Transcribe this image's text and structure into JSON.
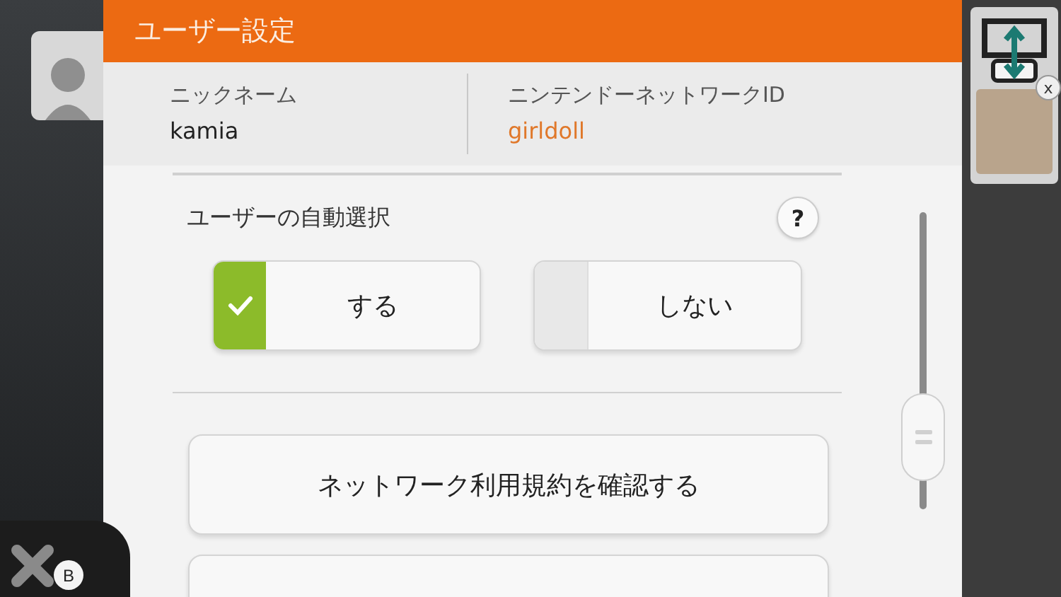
{
  "header": {
    "title": "ユーザー設定"
  },
  "account": [
    {
      "label": "ニックネーム",
      "value": "kamia",
      "kind": "plain"
    },
    {
      "label": "ニンテンドーネットワークID",
      "value": "girldoll",
      "kind": "id"
    }
  ],
  "auto_select": {
    "title": "ユーザーの自動選択",
    "help": "?",
    "options": [
      {
        "label": "する",
        "selected": true
      },
      {
        "label": "しない",
        "selected": false
      }
    ]
  },
  "buttons": [
    "ネットワーク利用規約を確認する"
  ],
  "close": {
    "badge": "B"
  },
  "switch_screen": {
    "badge": "x"
  }
}
